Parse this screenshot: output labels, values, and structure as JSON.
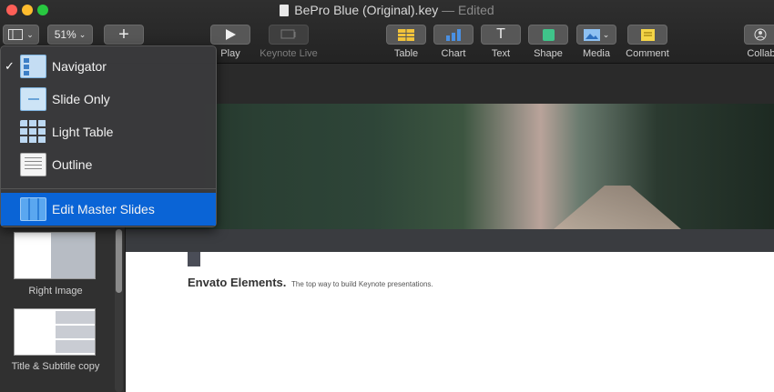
{
  "window": {
    "title": "BePro Blue (Original).key",
    "status": "— Edited"
  },
  "toolbar": {
    "zoom": "51%",
    "play_label": "Play",
    "keynote_live_label": "Keynote Live",
    "table_label": "Table",
    "chart_label": "Chart",
    "text_label": "Text",
    "shape_label": "Shape",
    "media_label": "Media",
    "comment_label": "Comment",
    "collaborate_label": "Collabo"
  },
  "view_menu": {
    "items": [
      {
        "label": "Navigator",
        "checked": "✓",
        "icon": "navigator-icon"
      },
      {
        "label": "Slide Only",
        "icon": "slide-only-icon"
      },
      {
        "label": "Light Table",
        "icon": "light-table-icon"
      },
      {
        "label": "Outline",
        "icon": "outline-icon"
      }
    ],
    "master_item": {
      "label": "Edit Master Slides",
      "icon": "edit-master-slides-icon"
    }
  },
  "navigator": {
    "thumbnails": [
      {
        "label": "Right Image"
      },
      {
        "label": "Title & Subtitle copy"
      }
    ]
  },
  "slide": {
    "heading": "Envato Elements.",
    "tagline": "The top way to build Keynote presentations."
  },
  "colors": {
    "accent": "#0a64d6",
    "toolbar_bg": "#2b2b2b"
  }
}
